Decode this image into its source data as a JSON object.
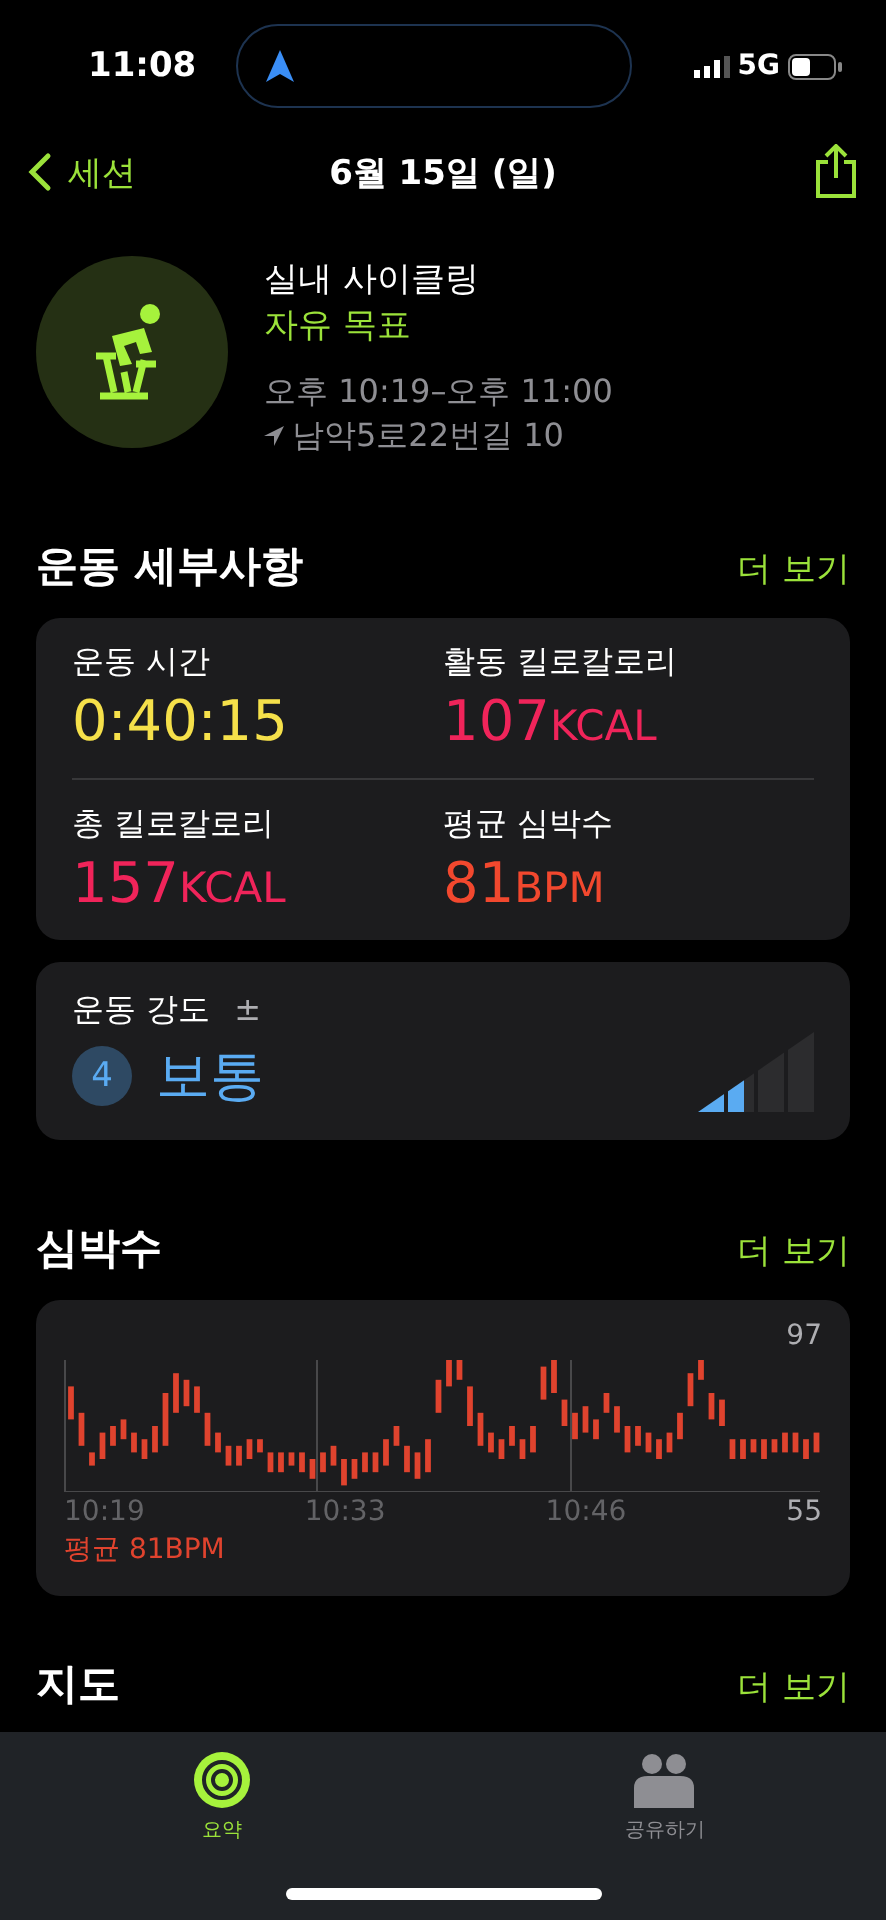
{
  "status_bar": {
    "time": "11:08",
    "network": "5G"
  },
  "nav": {
    "back": "세션",
    "title": "6월 15일 (일)"
  },
  "workout": {
    "name": "실내 사이클링",
    "goal": "자유 목표",
    "time_range": "오후 10:19–오후 11:00",
    "location": "남악5로22번길 10"
  },
  "details": {
    "title": "운동 세부사항",
    "more": "더 보기",
    "metrics": [
      {
        "label": "운동 시간",
        "value": "0:40:15",
        "color": "#f5e04a"
      },
      {
        "label": "활동 킬로칼로리",
        "value": "107",
        "unit": "KCAL",
        "color": "#f0245a"
      },
      {
        "label": "총 킬로칼로리",
        "value": "157",
        "unit": "KCAL",
        "color": "#f0245a"
      },
      {
        "label": "평균 심박수",
        "value": "81",
        "unit": "BPM",
        "color": "#f2482e"
      }
    ]
  },
  "intensity": {
    "label": "운동 강도",
    "sign": "±",
    "number": "4",
    "text": "보통",
    "level": 0.4
  },
  "heart_rate": {
    "title": "심박수",
    "more": "더 보기",
    "max": "97",
    "min": "55",
    "times": [
      "10:19",
      "10:33",
      "10:46"
    ],
    "average": "평균 81BPM"
  },
  "map": {
    "title": "지도",
    "more": "더 보기"
  },
  "tabs": [
    {
      "label": "요약",
      "selected": true
    },
    {
      "label": "공유하기",
      "selected": false
    }
  ]
}
